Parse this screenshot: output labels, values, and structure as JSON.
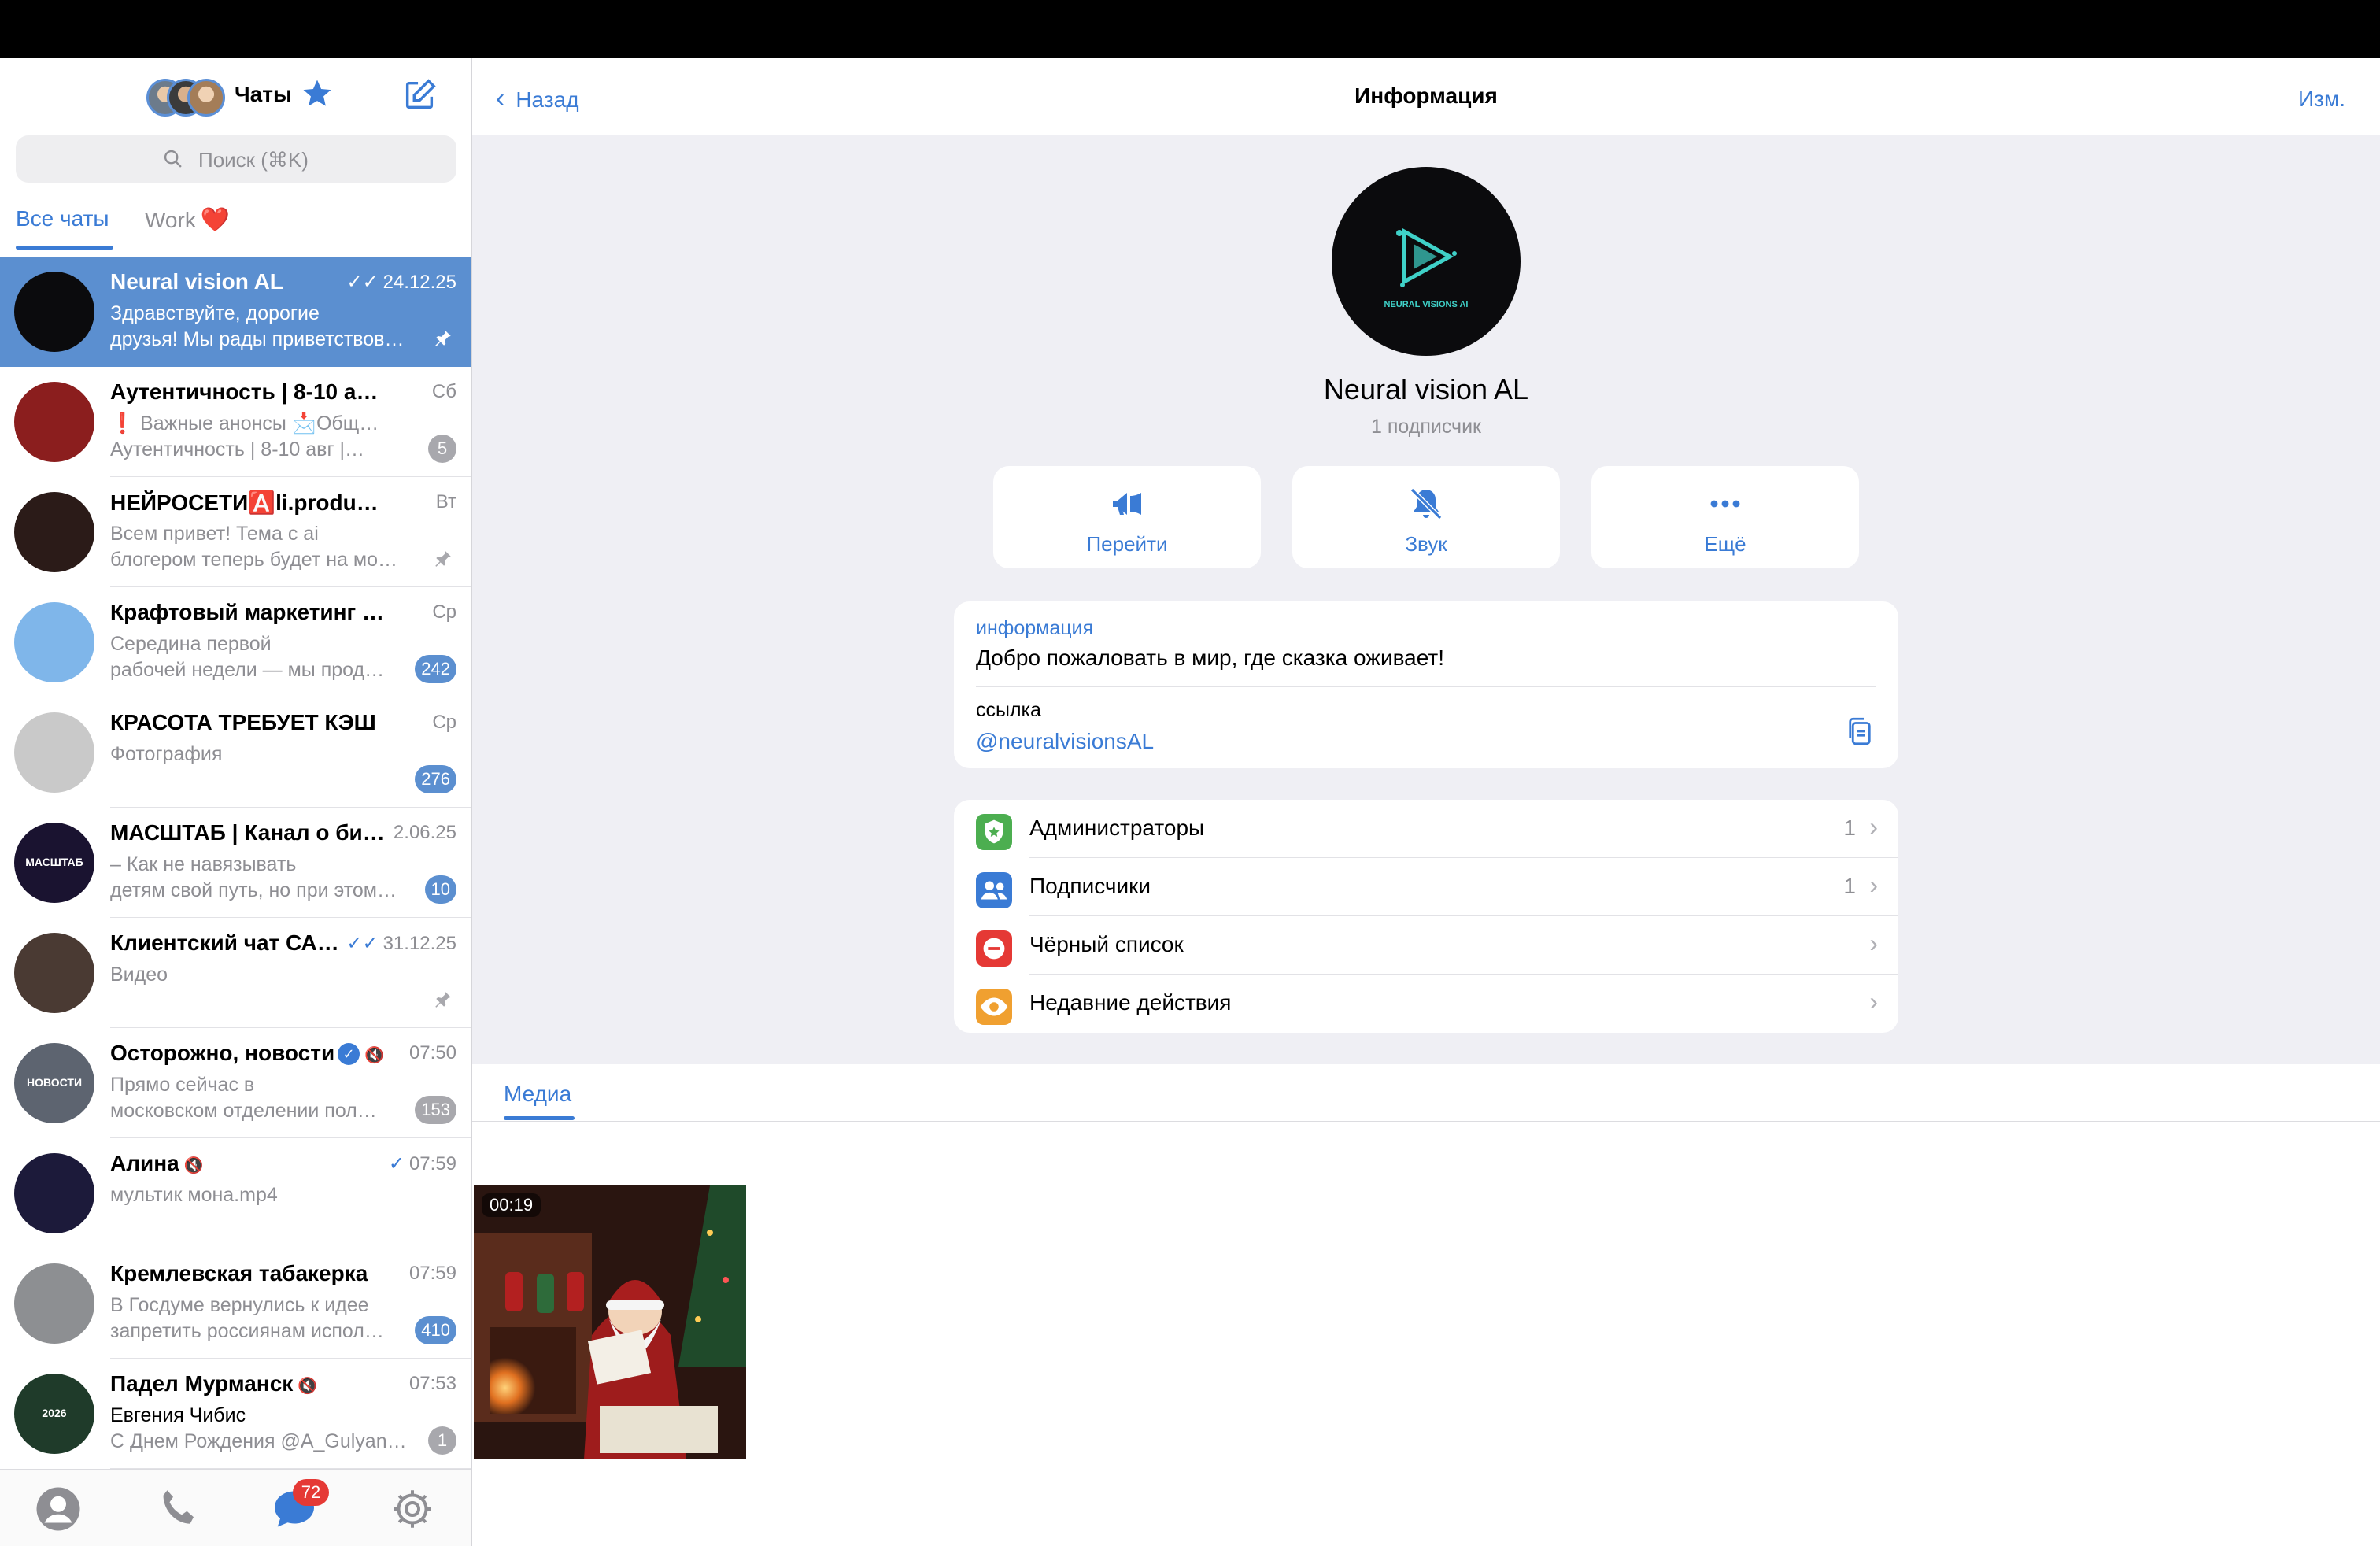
{
  "sidebar": {
    "title": "Чаты",
    "search_placeholder": "Поиск (⌘K)",
    "folders": [
      {
        "label": "Все чаты",
        "active": true
      },
      {
        "label": "Work",
        "emoji": "❤️",
        "active": false
      }
    ],
    "chats": [
      {
        "name": "Neural vision AL",
        "time": "24.12.25",
        "read_check": "✓✓",
        "line1": "Здравствуйте, дорогие",
        "line2": "друзья! Мы рады приветствов…",
        "pinned": true,
        "selected": true,
        "avatar_color": "#0b0b0d"
      },
      {
        "name": "Аутентичность | 8-10 авг…",
        "time": "Сб",
        "muted": true,
        "line1": "❗ Важные анонсы 📩Общ…",
        "line2": "Аутентичность | 8-10 авг |…",
        "badge": "5",
        "badge_muted": true,
        "avatar_color": "#8b1e1e"
      },
      {
        "name": "НЕЙРОСЕТИ🅰️li.productions",
        "time": "Вт",
        "line1": "Всем привет! Тема с ai",
        "line2": "блогером теперь будет на мо…",
        "pinned": true,
        "avatar_color": "#2b1b18"
      },
      {
        "name": "Крафтовый маркетинг | Alt…",
        "time": "Ср",
        "line1": "Середина первой",
        "line2": "рабочей недели — мы прод…",
        "badge": "242",
        "avatar_color": "#7fb6ea"
      },
      {
        "name": "КРАСОТА ТРЕБУЕТ КЭШ",
        "time": "Ср",
        "line1": "Фотография",
        "line2": "",
        "badge": "276",
        "avatar_color": "#c9c9c9"
      },
      {
        "name": "МАСШТАБ | Канал о би…",
        "time": "2.06.25",
        "line1": "– Как не навязывать",
        "line2": "детям свой путь, но при этом…",
        "badge": "10",
        "avatar_color": "#1a1330",
        "avatar_text": "МАСШТАБ"
      },
      {
        "name": "Клиентский чат СА…",
        "time": "31.12.25",
        "read_check": "✓✓",
        "line1": "Видео",
        "line2": "",
        "pinned": true,
        "avatar_color": "#4a3a33"
      },
      {
        "name": "Осторожно, новости",
        "time": "07:50",
        "verified": true,
        "muted": true,
        "line1": "Прямо сейчас в",
        "line2": "московском отделении пол…",
        "badge": "153",
        "badge_muted": true,
        "avatar_color": "#5d6470",
        "avatar_text": "НОВОСТИ"
      },
      {
        "name": "Алина",
        "time": "07:59",
        "read_check": "✓",
        "muted": true,
        "line1": "мультик мона.mp4",
        "line2": "",
        "avatar_color": "#1c1a3a"
      },
      {
        "name": "Кремлевская табакерка",
        "time": "07:59",
        "line1": "В Госдуме вернулись к идее",
        "line2": "запретить россиянам испол…",
        "badge": "410",
        "avatar_color": "#8d8f92"
      },
      {
        "name": "Падел Мурманск",
        "time": "07:53",
        "muted": true,
        "sender": "Евгения Чибис",
        "line1": "Евгения Чибис",
        "line2": "С Днем Рождения @A_Gulyan…",
        "badge": "1",
        "badge_muted": true,
        "avatar_color": "#1f3b2a",
        "avatar_text": "2026"
      }
    ],
    "tabbar": {
      "items": [
        "contacts-icon",
        "calls-icon",
        "chats-icon",
        "settings-icon"
      ],
      "unread_count": "72"
    }
  },
  "main": {
    "back_label": "Назад",
    "title": "Информация",
    "edit_label": "Изм.",
    "channel": {
      "name": "Neural vision AL",
      "subscribers": "1 подписчик",
      "logo_text": "NEURAL VISIONS AI"
    },
    "actions": [
      {
        "label": "Перейти",
        "icon": "megaphone-icon"
      },
      {
        "label": "Звук",
        "icon": "bell-slash-icon"
      },
      {
        "label": "Ещё",
        "icon": "more-icon"
      }
    ],
    "info": {
      "caption": "информация",
      "description": "Добро пожаловать в мир, где сказка оживает!",
      "link_caption": "ссылка",
      "link": "@neuralvisionsAL"
    },
    "menu": [
      {
        "label": "Администраторы",
        "count": "1",
        "icon": "shield-icon",
        "color": "#4cae50"
      },
      {
        "label": "Подписчики",
        "count": "1",
        "icon": "people-icon",
        "color": "#3a7bd5"
      },
      {
        "label": "Чёрный список",
        "count": "",
        "icon": "block-icon",
        "color": "#e53935"
      },
      {
        "label": "Недавние действия",
        "count": "",
        "icon": "eye-icon",
        "color": "#f0a030"
      }
    ],
    "media": {
      "tab_label": "Медиа",
      "items": [
        {
          "duration": "00:19"
        }
      ]
    }
  },
  "colors": {
    "accent": "#3a7bd5",
    "selected_row": "#5b8fd0",
    "unread_red": "#e53935"
  }
}
